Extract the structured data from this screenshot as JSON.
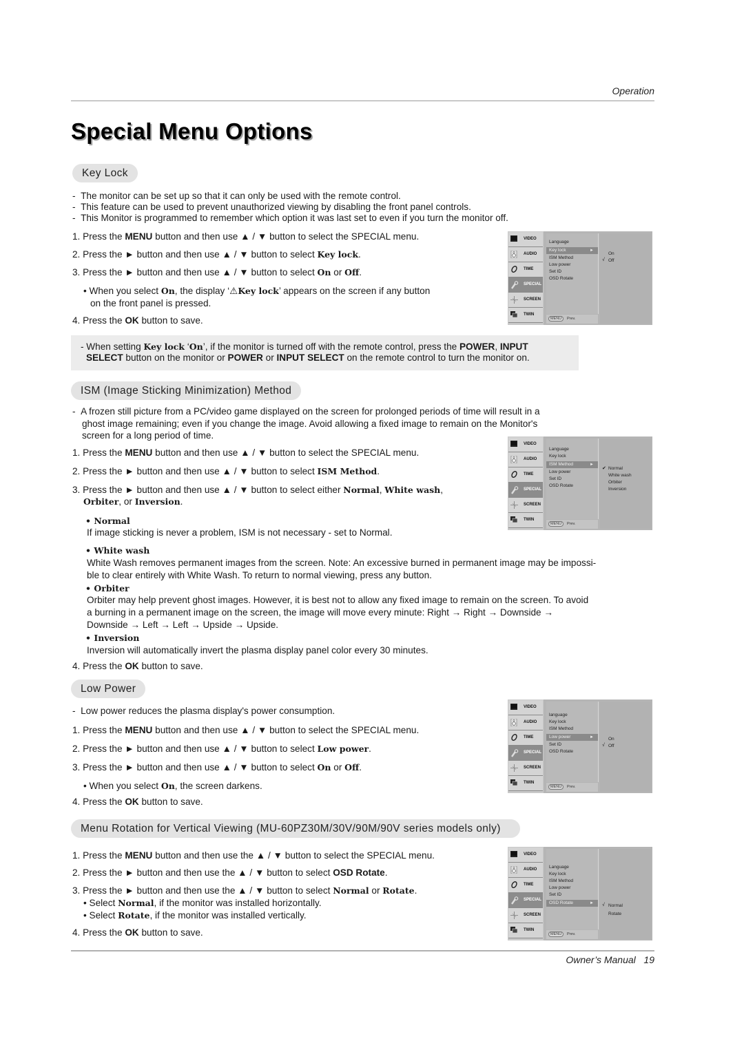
{
  "header": {
    "section_label": "Operation"
  },
  "page_title": "Special Menu Options",
  "sections": {
    "key_lock": {
      "title": "Key Lock",
      "intro": [
        "The monitor can be set up so that it can only be used with the remote control.",
        "This feature can be used to prevent unauthorized viewing by disabling the front panel controls.",
        "This Monitor is programmed to remember which option it was last set to even if you turn the monitor off."
      ],
      "steps": {
        "s1": {
          "num": "1.",
          "pre": "Press the ",
          "b1": "MENU",
          "mid": " button and then use ▲ / ▼  button to select the SPECIAL menu."
        },
        "s2": {
          "num": "2.",
          "pre": "Press the ► button and then use ▲ / ▼  button to select ",
          "b1": "Key lock",
          "post": "."
        },
        "s3": {
          "num": "3.",
          "pre": "Press the ► button and then use ▲ / ▼ button to select ",
          "b1": "On",
          "mid": " or ",
          "b2": "Off",
          "post": "."
        },
        "s3_bullet": {
          "pre": "• When you select ",
          "b1": "On",
          "mid": ", the display ‘",
          "icon": "⚠",
          "b2": "Key lock",
          "post": "’ appears on the screen if any button",
          "line2": "on the front panel is pressed."
        },
        "s4": {
          "num": "4.",
          "pre": "Press the ",
          "b1": "OK",
          "post": " button to save."
        }
      },
      "note": {
        "pre": "- When setting ",
        "b1": "Key lock",
        "q1": " ‘",
        "b2": "On",
        "mid": "’, if the monitor is turned off with the remote control, press the ",
        "b3": "POWER",
        "c1": ", ",
        "b4": "INPUT",
        "l2_b1": "SELECT",
        "l2_mid": " button on the monitor or ",
        "l2_b2": "POWER",
        "l2_or": " or ",
        "l2_b3": "INPUT SELECT",
        "l2_post": " on the remote control to turn the monitor on."
      },
      "osd": {
        "tabs": [
          "VIDEO",
          "AUDIO",
          "TIME",
          "SPECIAL",
          "SCREEN",
          "TWIN"
        ],
        "active_tab": "SPECIAL",
        "items": [
          "Language",
          "Key lock",
          "ISM Method",
          "Low power",
          "Set ID",
          "OSD Rotate"
        ],
        "selected_item": "Key lock",
        "options": [
          "On",
          "Off"
        ],
        "checked_option": "Off",
        "check_glyph": "√",
        "arrow": "►",
        "footer_menu": "MENU",
        "footer_prev": "Prev."
      }
    },
    "ism": {
      "title": "ISM (Image Sticking Minimization) Method",
      "intro": [
        "A frozen still picture from a PC/video game displayed on the screen for prolonged periods of time will result in a",
        "ghost image remaining; even if you change the image. Avoid allowing a fixed image to remain on the Monitor's",
        "screen for a long period of time."
      ],
      "steps": {
        "s1": {
          "num": "1.",
          "pre": "Press the ",
          "b1": "MENU",
          "mid": " button and then use ▲ / ▼  button to select the SPECIAL menu."
        },
        "s2": {
          "num": "2.",
          "pre": "Press the ►  button and then use ▲ / ▼ button to select ",
          "b1": "ISM Method",
          "post": "."
        },
        "s3": {
          "num": "3.",
          "pre": "Press the ►  button and then use ▲ / ▼ button to select either ",
          "b1": "Normal",
          "c1": ", ",
          "b2": "White wash",
          "c2": ",",
          "l2_b1": "Orbiter",
          "l2_mid": ", or ",
          "l2_b2": "Inversion",
          "l2_post": "."
        },
        "options": [
          {
            "name": "• Normal",
            "desc": [
              "If image sticking is never a problem, ISM is not necessary - set to Normal."
            ]
          },
          {
            "name": "• White wash",
            "desc": [
              "White Wash removes permanent images from the screen. Note: An excessive burned in permanent image may be impossi-",
              "ble to clear entirely with White Wash. To return to normal viewing, press any button."
            ]
          },
          {
            "name": "• Orbiter",
            "desc": [
              "Orbiter may help prevent ghost images. However, it is best not to allow any fixed image to remain on the screen. To avoid",
              "a burning in a permanent image on the screen, the image will move every minute: Right → Right → Downside →",
              "Downside → Left → Left → Upside → Upside."
            ]
          },
          {
            "name": "• Inversion",
            "desc": [
              "Inversion will automatically invert the plasma display panel color every 30 minutes."
            ]
          }
        ],
        "s4": {
          "num": "4.",
          "pre": "Press the ",
          "b1": "OK",
          "post": " button to save."
        }
      },
      "osd": {
        "tabs": [
          "VIDEO",
          "AUDIO",
          "TIME",
          "SPECIAL",
          "SCREEN",
          "TWIN"
        ],
        "active_tab": "SPECIAL",
        "items": [
          "Language",
          "Key lock",
          "ISM Method",
          "Low power",
          "Set ID",
          "OSD Rotate"
        ],
        "selected_item": "ISM Method",
        "options": [
          "Normal",
          "White wash",
          "Orbiter",
          "Inversion"
        ],
        "checked_option": "Normal",
        "check_glyph": "✔",
        "arrow": "►",
        "footer_menu": "MENU",
        "footer_prev": "Prev."
      }
    },
    "low_power": {
      "title": "Low Power",
      "intro": [
        "Low power reduces the plasma display's power consumption."
      ],
      "steps": {
        "s1": {
          "num": "1.",
          "pre": "Press the ",
          "b1": "MENU",
          "mid": " button and then use ▲ / ▼  button to select the SPECIAL menu."
        },
        "s2": {
          "num": "2.",
          "pre": "Press the ►  button and then use ▲ / ▼ button to select ",
          "b1": "Low power",
          "post": "."
        },
        "s3": {
          "num": "3.",
          "pre": "Press the ►  button and then use ▲ / ▼ button to select ",
          "b1": "On",
          "mid": " or ",
          "b2": "Off",
          "post": "."
        },
        "s3_bullet": {
          "pre": "• When you select ",
          "b1": "On",
          "post": ", the screen darkens."
        },
        "s4": {
          "num": "4.",
          "pre": "Press the ",
          "b1": "OK",
          "post": " button to save."
        }
      },
      "osd": {
        "tabs": [
          "VIDEO",
          "AUDIO",
          "TIME",
          "SPECIAL",
          "SCREEN",
          "TWIN"
        ],
        "active_tab": "SPECIAL",
        "items": [
          "language",
          "Key lock",
          "ISM Method",
          "Low power",
          "Set ID",
          "OSD Rotate"
        ],
        "selected_item": "Low power",
        "options": [
          "On",
          "Off"
        ],
        "checked_option": "Off",
        "check_glyph": "√",
        "arrow": "►",
        "footer_menu": "MENU",
        "footer_prev": "Prev."
      }
    },
    "menu_rotation": {
      "title": "Menu Rotation for Vertical Viewing (MU-60PZ30M/30V/90M/90V series models only)",
      "steps": {
        "s1": {
          "num": "1.",
          "pre": "Press the ",
          "b1": "MENU",
          "mid": " button and then use the ▲ / ▼  button to select the SPECIAL menu."
        },
        "s2": {
          "num": "2.",
          "pre": "Press the ► button and then use the ▲ / ▼  button to select ",
          "b1": "OSD Rotate",
          "post": "."
        },
        "s3": {
          "num": "3.",
          "pre": "Press the ► button and then use the ▲ / ▼ button to select ",
          "b1": "Normal",
          "mid": " or ",
          "b2": "Rotate",
          "post": "."
        },
        "s3_b1": {
          "pre": "• Select ",
          "b1": "Normal",
          "post": ", if the monitor was installed horizontally."
        },
        "s3_b2": {
          "pre": "• Select ",
          "b1": "Rotate",
          "post": ", if the monitor was installed vertically."
        },
        "s4": {
          "num": "4.",
          "pre": "Press the ",
          "b1": "OK",
          "post": " button to save."
        }
      },
      "osd": {
        "tabs": [
          "VIDEO",
          "AUDIO",
          "TIME",
          "SPECIAL",
          "SCREEN",
          "TWIN"
        ],
        "active_tab": "SPECIAL",
        "items": [
          "Language",
          "Key lock",
          "ISM Method",
          "Low power",
          "Set ID",
          "OSD Rotate"
        ],
        "selected_item": "OSD Rotate",
        "options": [
          "Normal",
          "Rotate"
        ],
        "checked_option": "Normal",
        "check_glyph": "√",
        "arrow": "►",
        "footer_menu": "MENU",
        "footer_prev": "Prev."
      }
    }
  },
  "footer": {
    "label": "Owner’s Manual",
    "page_number": "19"
  }
}
